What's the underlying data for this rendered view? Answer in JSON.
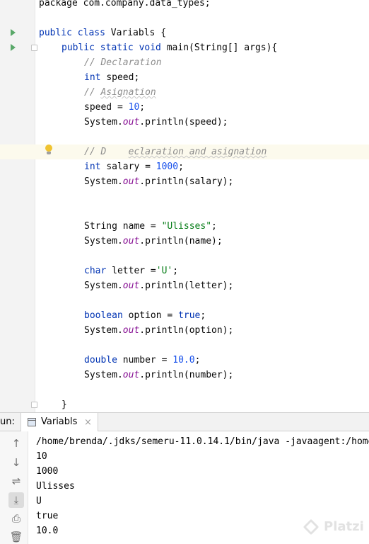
{
  "editor": {
    "lines": [
      [
        {
          "t": "package com.company.data_types;",
          "c": "plain"
        }
      ],
      [],
      [
        {
          "t": "public class ",
          "c": "kw"
        },
        {
          "t": "Variabls {",
          "c": "plain"
        }
      ],
      [
        {
          "t": "public static void ",
          "c": "kw"
        },
        {
          "t": "main(String[] args){",
          "c": "plain"
        }
      ],
      [
        {
          "t": "// Declaration",
          "c": "cmt"
        }
      ],
      [
        {
          "t": "int ",
          "c": "kw"
        },
        {
          "t": "speed;",
          "c": "plain"
        }
      ],
      [
        {
          "t": "// ",
          "c": "cmt"
        },
        {
          "t": "Asignation",
          "c": "cmt cmt-u"
        }
      ],
      [
        {
          "t": "speed = ",
          "c": "plain"
        },
        {
          "t": "10",
          "c": "num"
        },
        {
          "t": ";",
          "c": "plain"
        }
      ],
      [
        {
          "t": "System.",
          "c": "plain"
        },
        {
          "t": "out",
          "c": "static-f"
        },
        {
          "t": ".println(speed);",
          "c": "plain"
        }
      ],
      [],
      [
        {
          "t": "// D    ",
          "c": "cmt"
        },
        {
          "t": "eclaration and asignation",
          "c": "cmt cmt-u"
        }
      ],
      [
        {
          "t": "int ",
          "c": "kw"
        },
        {
          "t": "salary = ",
          "c": "plain"
        },
        {
          "t": "1000",
          "c": "num"
        },
        {
          "t": ";",
          "c": "plain"
        }
      ],
      [
        {
          "t": "System.",
          "c": "plain"
        },
        {
          "t": "out",
          "c": "static-f"
        },
        {
          "t": ".println(salary);",
          "c": "plain"
        }
      ],
      [],
      [],
      [
        {
          "t": "String name = ",
          "c": "plain"
        },
        {
          "t": "\"Ulisses\"",
          "c": "str"
        },
        {
          "t": ";",
          "c": "plain"
        }
      ],
      [
        {
          "t": "System.",
          "c": "plain"
        },
        {
          "t": "out",
          "c": "static-f"
        },
        {
          "t": ".println(name);",
          "c": "plain"
        }
      ],
      [],
      [
        {
          "t": "char ",
          "c": "kw"
        },
        {
          "t": "letter =",
          "c": "plain"
        },
        {
          "t": "'U'",
          "c": "str"
        },
        {
          "t": ";",
          "c": "plain"
        }
      ],
      [
        {
          "t": "System.",
          "c": "plain"
        },
        {
          "t": "out",
          "c": "static-f"
        },
        {
          "t": ".println(letter);",
          "c": "plain"
        }
      ],
      [],
      [
        {
          "t": "boolean ",
          "c": "kw"
        },
        {
          "t": "option = ",
          "c": "plain"
        },
        {
          "t": "true",
          "c": "kw"
        },
        {
          "t": ";",
          "c": "plain"
        }
      ],
      [
        {
          "t": "System.",
          "c": "plain"
        },
        {
          "t": "out",
          "c": "static-f"
        },
        {
          "t": ".println(option);",
          "c": "plain"
        }
      ],
      [],
      [
        {
          "t": "double ",
          "c": "kw"
        },
        {
          "t": "number = ",
          "c": "plain"
        },
        {
          "t": "10.0",
          "c": "num"
        },
        {
          "t": ";",
          "c": "plain"
        }
      ],
      [
        {
          "t": "System.",
          "c": "plain"
        },
        {
          "t": "out",
          "c": "static-f"
        },
        {
          "t": ".println(number);",
          "c": "plain"
        }
      ],
      [],
      [
        {
          "t": "}",
          "c": "plain"
        }
      ],
      [
        {
          "t": "}",
          "c": "plain"
        }
      ]
    ]
  },
  "run": {
    "label": "un:",
    "tab_label": "Variabls",
    "tab_close": "×",
    "toolbar_icons": [
      "arrow-up-icon",
      "arrow-down-icon",
      "soft-wrap-icon",
      "scroll-to-end-icon",
      "print-icon",
      "trash-icon"
    ],
    "output": [
      "/home/brenda/.jdks/semeru-11.0.14.1/bin/java -javaagent:/home",
      "10",
      "1000",
      "Ulisses",
      "U",
      "true",
      "10.0"
    ]
  },
  "watermark": {
    "text": "Platzi"
  },
  "colors": {
    "keyword": "#0033b3",
    "number": "#1750eb",
    "string": "#067d17",
    "comment": "#8c8c8c",
    "static_field": "#871094",
    "run_arrow": "#59a869",
    "current_line": "#fcfaed"
  }
}
